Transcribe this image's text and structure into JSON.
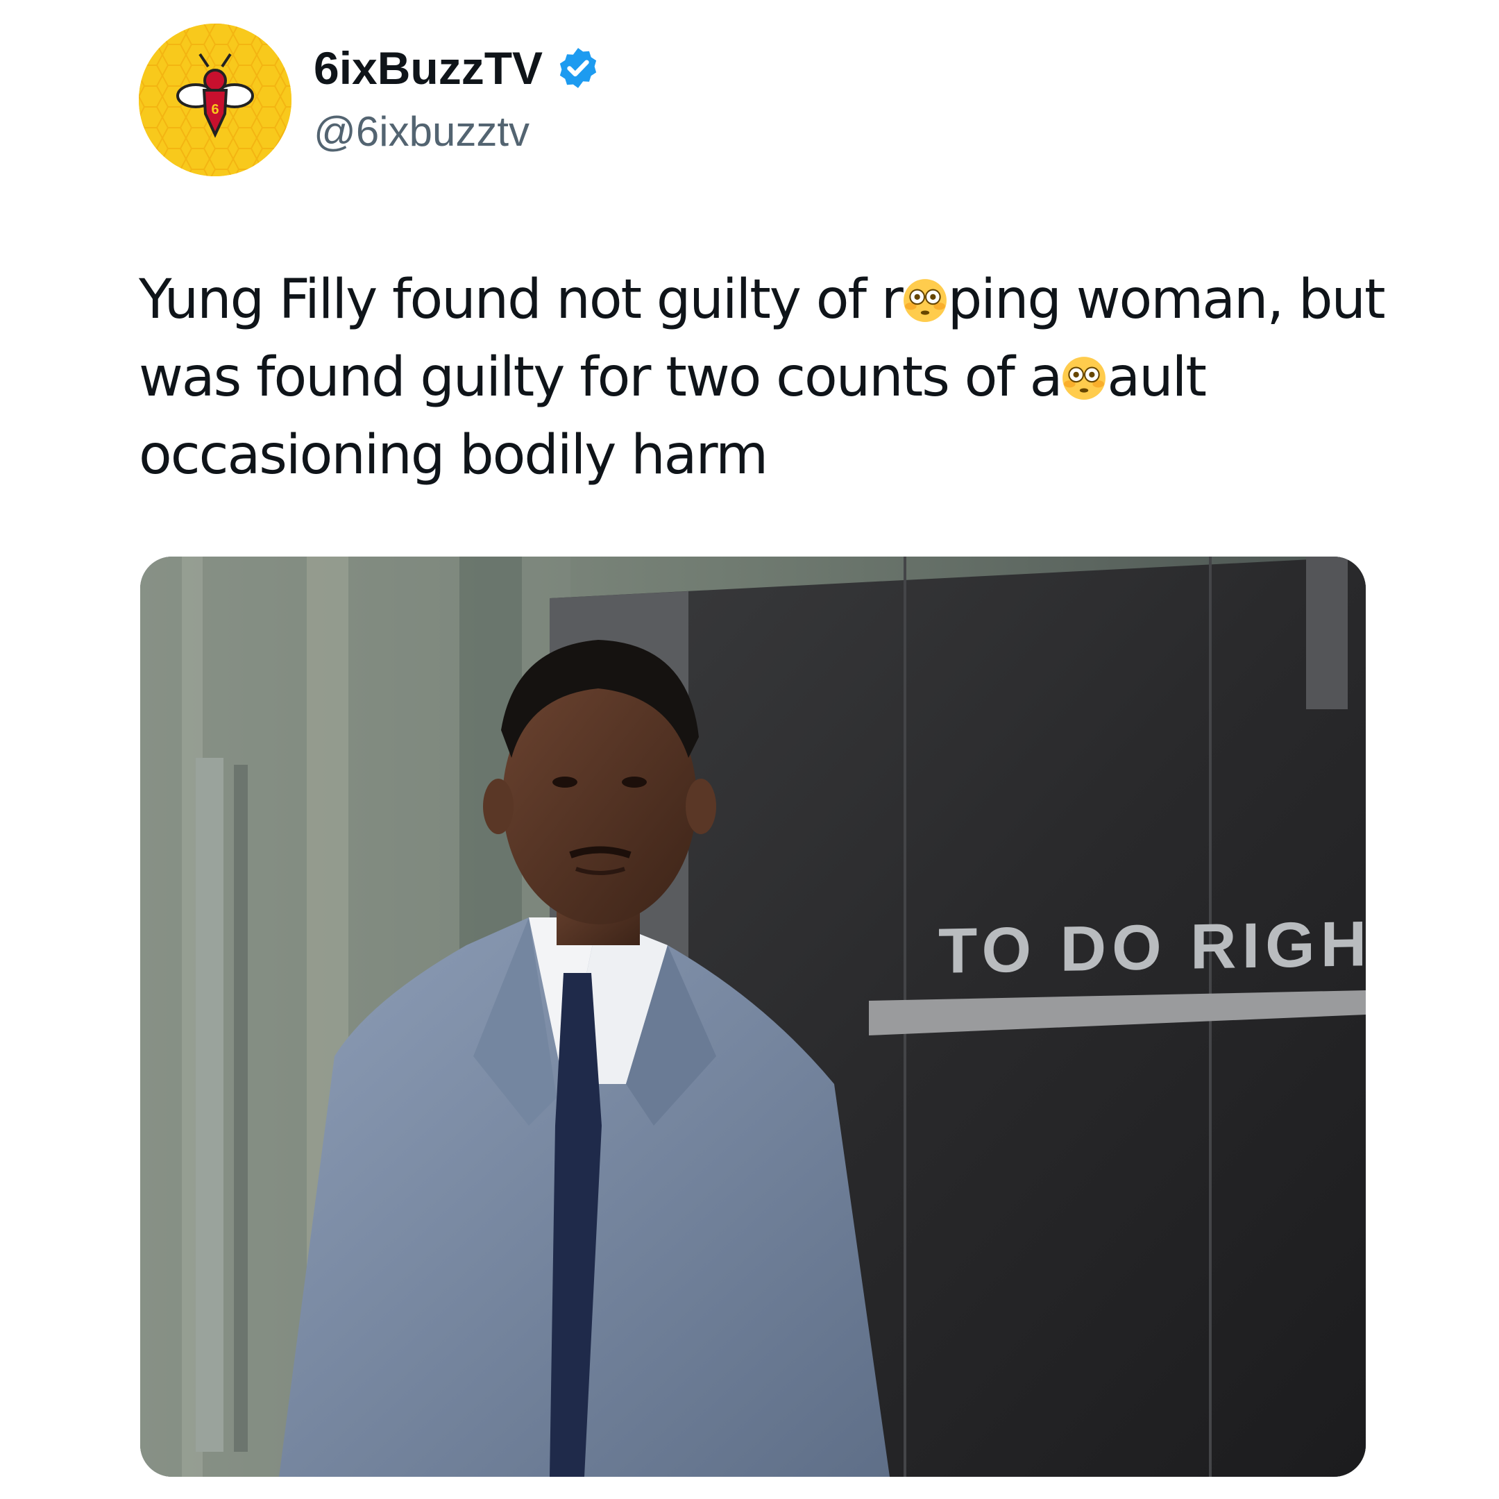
{
  "account": {
    "display_name": "6ixBuzzTV",
    "handle": "@6ixbuzztv",
    "verified": true,
    "avatar_icon": "bee-logo-icon",
    "avatar_text": "6"
  },
  "tweet": {
    "segments": {
      "s1": "Yung Filly found not guilty of r",
      "e1": "flushed-face-emoji",
      "s2": "ping woman, but was found guilty for two counts of a",
      "e2": "flushed-face-emoji",
      "s3": "ault occasioning bodily harm"
    }
  },
  "media": {
    "type": "photo",
    "wall_text": "TO DO RIGHT TO"
  },
  "colors": {
    "avatar_bg": "#f8c91c",
    "verified_blue": "#1d9bf0",
    "text_primary": "#0f1419",
    "text_secondary": "#536471"
  }
}
